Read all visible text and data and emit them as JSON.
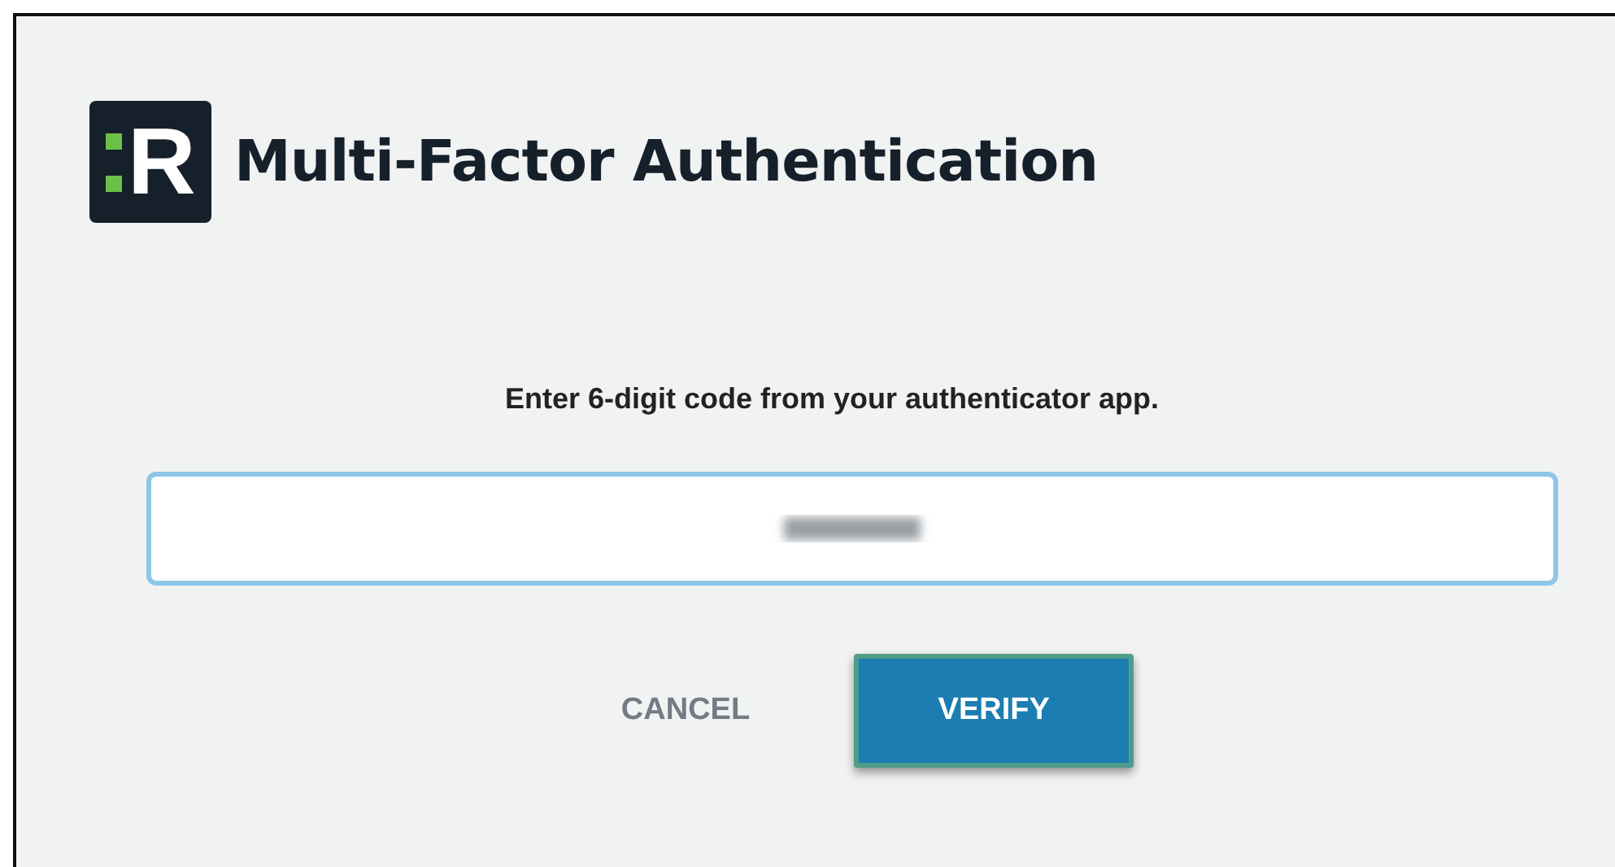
{
  "logo": {
    "letter": "R"
  },
  "title": "Multi-Factor Authentication",
  "instruction": "Enter 6-digit code from your authenticator app.",
  "code_field": {
    "redacted": true
  },
  "buttons": [
    {
      "label": "CANCEL",
      "kind": "text"
    },
    {
      "label": "VERIFY",
      "kind": "primary",
      "focused": true
    }
  ]
}
